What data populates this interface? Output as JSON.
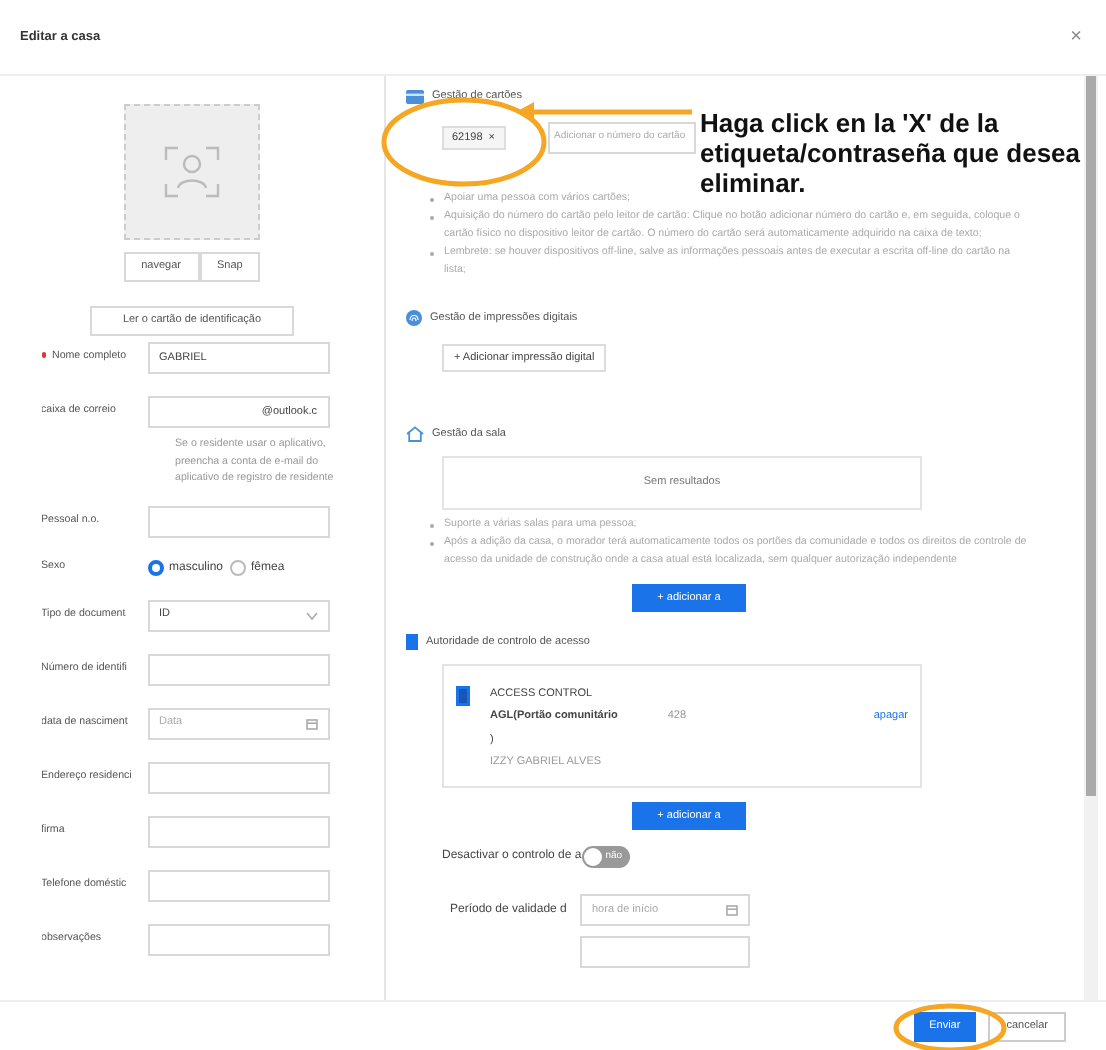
{
  "dialog": {
    "title": "Editar a casa",
    "close": "×"
  },
  "left": {
    "photo_buttons": [
      "navegar",
      "Snap"
    ],
    "read_card_button": "Ler o cartão de identificação",
    "fields": [
      {
        "kind": "text",
        "label": "Nome completo",
        "required": true,
        "value": "GABRIEL"
      },
      {
        "kind": "text",
        "label": "caixa de correio",
        "required": false,
        "value": "@outlook.c",
        "hint": "Se o residente usar o aplicativo, preencha a conta de e-mail do aplicativo de registro de residente"
      },
      {
        "kind": "text",
        "label": "Pessoal n.o.",
        "required": false
      },
      {
        "kind": "radio",
        "label": "Sexo",
        "required": false,
        "options": [
          {
            "label": "masculino",
            "selected": true
          },
          {
            "label": "fêmea",
            "selected": false
          }
        ]
      },
      {
        "kind": "select",
        "label": "Tipo de document",
        "required": false,
        "value": "ID"
      },
      {
        "kind": "text",
        "label": "Número de identifi",
        "required": false
      },
      {
        "kind": "date",
        "label": "data de nasciment",
        "required": false,
        "placeholder": "Data"
      },
      {
        "kind": "text",
        "label": "Endereço residenci",
        "required": false
      },
      {
        "kind": "text",
        "label": "firma",
        "required": false
      },
      {
        "kind": "text",
        "label": "Telefone doméstic",
        "required": false
      },
      {
        "kind": "text",
        "label": "observações",
        "required": false
      }
    ]
  },
  "cards": {
    "title": "Gestão de cartões",
    "tags": [
      {
        "label": "62198",
        "remove": "×"
      }
    ],
    "placeholder": "Adicionar o número do cartão",
    "notes": [
      "Apoiar uma pessoa com vários cartões;",
      "Aquisição do número do cartão pelo leitor de cartão: Clique no botão adicionar número do cartão e, em seguida, coloque o cartão físico no dispositivo leitor de cartão. O número do cartão será automaticamente adquirido na caixa de texto;",
      "Lembrete: se houver dispositivos off-line, salve as informações pessoais antes de executar a escrita off-line do cartão na lista;"
    ]
  },
  "fingerprints": {
    "title": "Gestão de impressões digitais",
    "button": "+ Adicionar impressão digital"
  },
  "rooms": {
    "title": "Gestão da sala",
    "empty": "Sem resultados",
    "notes": [
      "Suporte a várias salas para uma pessoa;",
      "Após a adição da casa, o morador terá automaticamente todos os portões da comunidade e todos os direitos de controle de acesso da unidade de construção onde a casa atual está localizada, sem qualquer autorização independente"
    ],
    "button": {
      "icon": "+",
      "label": "adicionar a"
    }
  },
  "access": {
    "title": "Autoridade de controlo de acesso",
    "entries": [
      {
        "title": "ACCESS CONTROL",
        "name": "AGL(Portão comunitário",
        "code": "428",
        "close_paren": ")",
        "person": "IZZY GABRIEL ALVES",
        "action": "apagar"
      }
    ],
    "button": {
      "icon": "+",
      "label": "adicionar a"
    },
    "toggle": {
      "label": "Desactivar o controlo de a",
      "on": false,
      "text": "não"
    },
    "validity": {
      "label": "Período de validade d",
      "placeholder": "hora de início"
    }
  },
  "footer": {
    "buttons": [
      {
        "label": "Enviar",
        "kind": "primary"
      },
      {
        "label": "cancelar",
        "kind": "secondary"
      }
    ]
  },
  "annotation": {
    "text": "Haga click  en la 'X' de la etiqueta/contraseña que desea eliminar."
  }
}
